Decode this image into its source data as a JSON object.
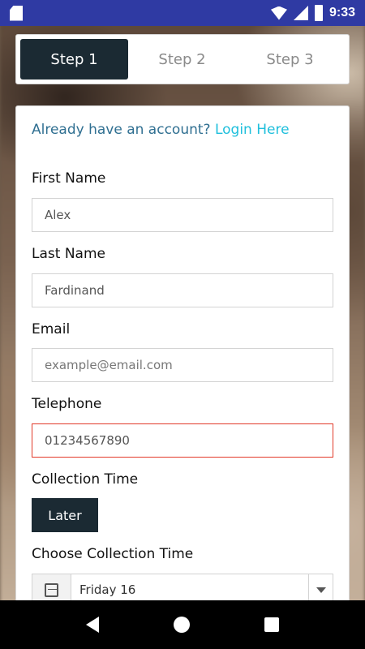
{
  "status_bar": {
    "time": "9:33"
  },
  "steps": [
    {
      "label": "Step 1",
      "active": true
    },
    {
      "label": "Step 2",
      "active": false
    },
    {
      "label": "Step 3",
      "active": false
    }
  ],
  "login": {
    "prompt": "Already have an account?",
    "link": "Login Here"
  },
  "form": {
    "first_name": {
      "label": "First Name",
      "value": "Alex"
    },
    "last_name": {
      "label": "Last Name",
      "value": "Fardinand"
    },
    "email": {
      "label": "Email",
      "placeholder": "example@email.com"
    },
    "telephone": {
      "label": "Telephone",
      "value": "01234567890"
    },
    "collection_time": {
      "label": "Collection Time",
      "button": "Later"
    },
    "choose_collection_time": {
      "label": "Choose Collection Time",
      "selected": "Friday 16"
    }
  },
  "colors": {
    "accent": "#1b2a33",
    "link": "#1fbfdc",
    "status_bar": "#2f3aa3",
    "error_border": "#e23a2a"
  },
  "icons": {
    "sd_card": "sd-card-icon",
    "wifi": "wifi-icon",
    "signal": "signal-icon",
    "battery": "battery-icon",
    "calendar": "calendar-icon",
    "chevron": "chevron-down-icon"
  }
}
